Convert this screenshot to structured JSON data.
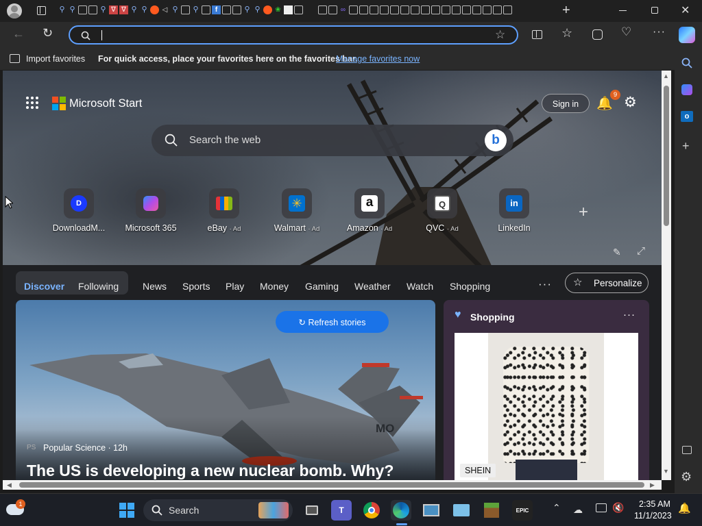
{
  "browser": {
    "address_value": "",
    "favorites_bar": {
      "import_label": "Import favorites",
      "prompt_text": "For quick access, place your favorites here on the favorites bar.",
      "manage_link": "Manage favorites now"
    }
  },
  "start": {
    "brand": "Microsoft Start",
    "sign_in": "Sign in",
    "notification_count": "9",
    "search_placeholder": "Search the web",
    "quick_links": [
      {
        "label": "DownloadM...",
        "ad": "",
        "icon": "D"
      },
      {
        "label": "Microsoft 365",
        "ad": "",
        "icon": ""
      },
      {
        "label": "eBay",
        "ad": "· Ad",
        "icon": ""
      },
      {
        "label": "Walmart",
        "ad": "· Ad",
        "icon": ""
      },
      {
        "label": "Amazon",
        "ad": "· Ad",
        "icon": "a"
      },
      {
        "label": "QVC",
        "ad": "· Ad",
        "icon": "Q"
      },
      {
        "label": "LinkedIn",
        "ad": "",
        "icon": "in"
      }
    ],
    "feed_tabs": [
      "Discover",
      "Following",
      "News",
      "Sports",
      "Play",
      "Money",
      "Gaming",
      "Weather",
      "Watch",
      "Shopping"
    ],
    "personalize": "Personalize",
    "refresh": "Refresh stories",
    "headline": {
      "source_badge": "PS",
      "source": "Popular Science · 12h",
      "title": "The US is developing a new nuclear bomb. Why?",
      "tail_markings": "MO"
    },
    "shopping": {
      "title": "Shopping",
      "brand": "SHEIN"
    }
  },
  "taskbar": {
    "search_label": "Search",
    "time": "2:35 AM",
    "date": "11/1/2023",
    "weather_badge": "1"
  },
  "colors": {
    "accent": "#5ea0ff",
    "link": "#7ab4ff",
    "badge": "#e0601f"
  }
}
